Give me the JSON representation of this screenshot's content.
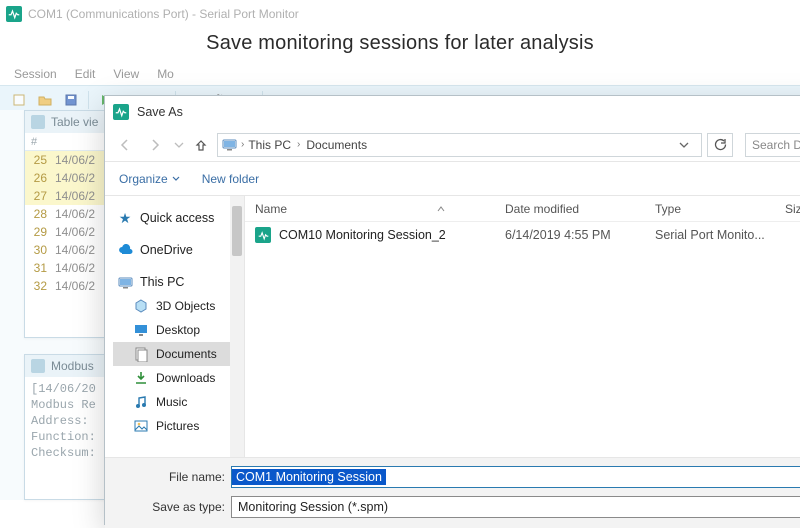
{
  "app": {
    "title": "COM1 (Communications Port) - Serial Port Monitor",
    "banner": "Save monitoring sessions for later analysis",
    "menus": [
      "Session",
      "Edit",
      "View",
      "Mo"
    ],
    "panels": {
      "table": {
        "title": "Table vie",
        "head": "#"
      },
      "modbus": {
        "title": "Modbus",
        "lines": [
          "[14/06/20",
          "Modbus Re",
          "Address:",
          "Function:",
          "Checksum:"
        ]
      }
    },
    "rows": [
      {
        "n": "25",
        "t": "14/06/2",
        "yl": true
      },
      {
        "n": "26",
        "t": "14/06/2",
        "yl": true
      },
      {
        "n": "27",
        "t": "14/06/2",
        "yl": true
      },
      {
        "n": "28",
        "t": "14/06/2",
        "yl": false
      },
      {
        "n": "29",
        "t": "14/06/2",
        "yl": false
      },
      {
        "n": "30",
        "t": "14/06/2",
        "yl": false
      },
      {
        "n": "31",
        "t": "14/06/2",
        "yl": false
      },
      {
        "n": "32",
        "t": "14/06/2",
        "yl": false
      }
    ]
  },
  "dlg": {
    "title": "Save As",
    "path": {
      "root": "This PC",
      "folder": "Documents"
    },
    "search": {
      "placeholder": "Search Documents"
    },
    "cmd": {
      "organize": "Organize",
      "newfolder": "New folder"
    },
    "cols": {
      "name": "Name",
      "date": "Date modified",
      "type": "Type",
      "size": "Size"
    },
    "files": [
      {
        "name": "COM10 Monitoring Session_2",
        "date": "6/14/2019 4:55 PM",
        "type": "Serial Port Monito..."
      }
    ],
    "nav": {
      "quickaccess": "Quick access",
      "onedrive": "OneDrive",
      "thispc": "This PC",
      "threed": "3D Objects",
      "desktop": "Desktop",
      "documents": "Documents",
      "downloads": "Downloads",
      "music": "Music",
      "pictures": "Pictures"
    },
    "bottom": {
      "filenamelbl": "File name:",
      "filename": "COM1 Monitoring Session",
      "typelbl": "Save as type:",
      "type": "Monitoring Session (*.spm)"
    },
    "icons": {
      "quickaccess_color": "#2a7ab0",
      "onedrive_color": "#0a64a4",
      "thispc_color": "#1e73b8",
      "folder_color": "#f2c15c"
    }
  }
}
